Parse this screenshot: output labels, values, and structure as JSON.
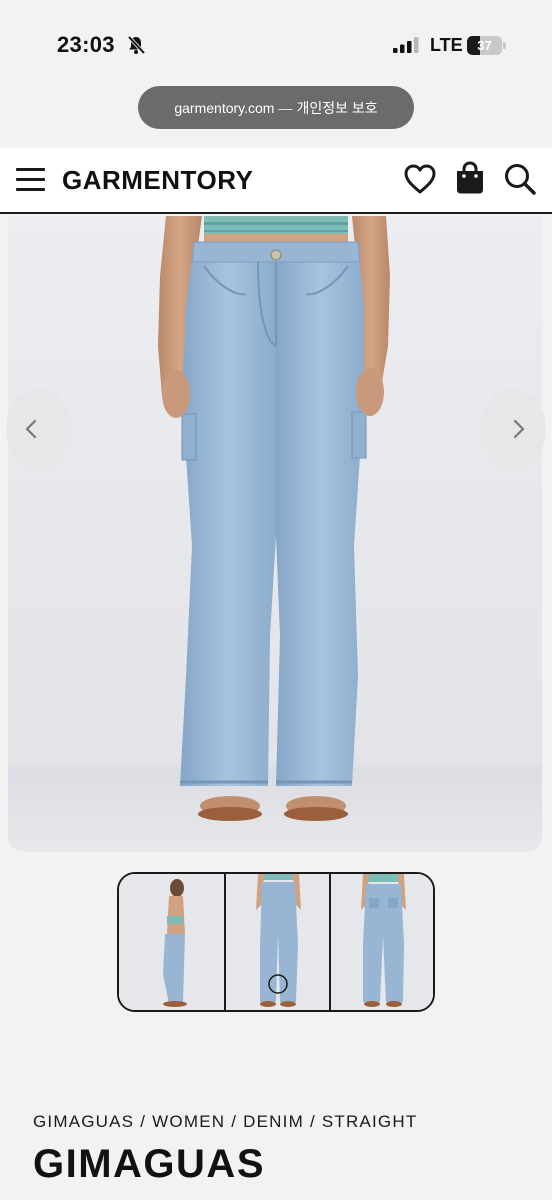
{
  "status_bar": {
    "time": "23:03",
    "network": "LTE",
    "battery": "37",
    "battery_level": 0.37
  },
  "browser": {
    "domain": "garmentory.com",
    "separator": "—",
    "privacy_label": "개인정보 보호"
  },
  "header": {
    "logo": "GARMENTORY"
  },
  "icons": {
    "menu": "menu-icon",
    "wishlist": "heart-icon",
    "bag": "shopping-bag-icon",
    "search": "search-icon",
    "prev": "chevron-left-icon",
    "next": "chevron-right-icon",
    "silence": "bell-slash-icon"
  },
  "gallery": {
    "main_alt": "Light wash flared denim jeans",
    "thumbnails": [
      "side view",
      "front view",
      "back view"
    ],
    "active_index": 1
  },
  "product": {
    "breadcrumb": [
      "GIMAGUAS",
      "WOMEN",
      "DENIM",
      "STRAIGHT"
    ],
    "brand": "GIMAGUAS"
  },
  "colors": {
    "denim": "#9dbbd8",
    "denim_dark": "#7f9fc2",
    "background": "#f2f2f2",
    "accent": "#1a1a1a"
  }
}
